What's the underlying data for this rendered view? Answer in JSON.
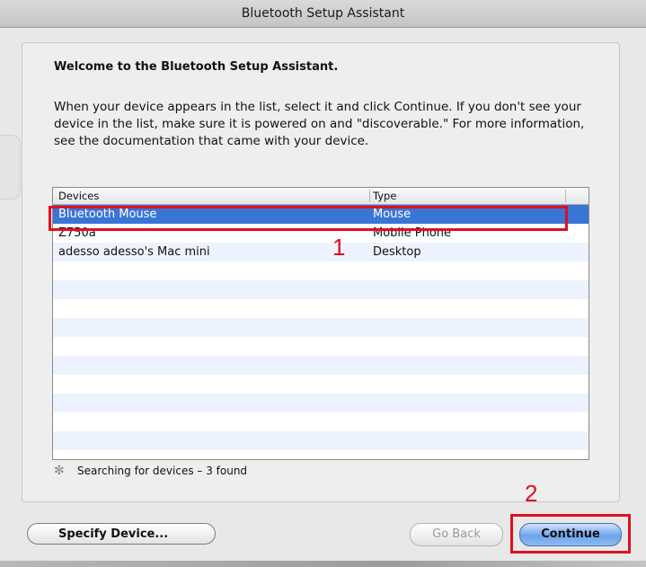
{
  "window": {
    "title": "Bluetooth Setup Assistant"
  },
  "intro": {
    "heading": "Welcome to the Bluetooth Setup Assistant.",
    "body": "When your device appears in the list, select it and click Continue. If you don't see your device in the list, make sure it is powered on and \"discoverable.\" For more information, see the documentation that came with your device."
  },
  "table": {
    "columns": [
      "Devices",
      "Type"
    ],
    "rows": [
      {
        "name": "Bluetooth Mouse",
        "type": "Mouse",
        "selected": true
      },
      {
        "name": "Z750a",
        "type": "Mobile Phone",
        "selected": false
      },
      {
        "name": "adesso adesso's Mac mini",
        "type": "Desktop",
        "selected": false
      }
    ]
  },
  "status": {
    "text": "Searching for devices – 3 found",
    "icon": "spinner-icon"
  },
  "buttons": {
    "specify": "Specify Device...",
    "back": "Go Back",
    "continue": "Continue"
  },
  "annotations": {
    "marker1": "1",
    "marker2": "2",
    "color": "#e0101e"
  },
  "colors": {
    "selection": "#3875d7",
    "row_alt": "#edf3fe"
  }
}
